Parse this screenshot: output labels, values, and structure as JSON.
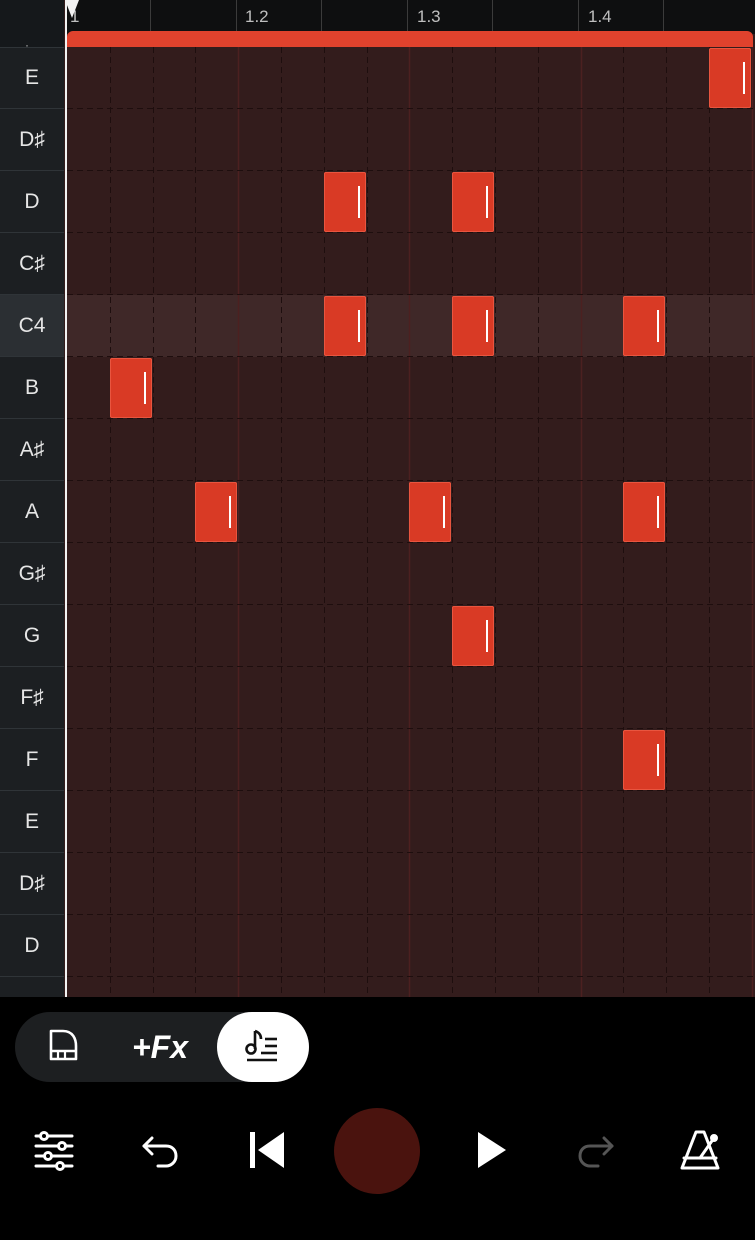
{
  "ruler": {
    "labels": [
      "1",
      "1.2",
      "1.3",
      "1.4"
    ]
  },
  "keys": [
    "E",
    "D♯",
    "D",
    "C♯",
    "C4",
    "B",
    "A♯",
    "A",
    "G♯",
    "G",
    "F♯",
    "F",
    "E",
    "D♯",
    "D"
  ],
  "highlight_key": "C4",
  "notes": [
    {
      "pitch": "D",
      "step": 6
    },
    {
      "pitch": "D",
      "step": 9
    },
    {
      "pitch": "C4",
      "step": 6
    },
    {
      "pitch": "C4",
      "step": 9
    },
    {
      "pitch": "C4",
      "step": 13
    },
    {
      "pitch": "B",
      "step": 1
    },
    {
      "pitch": "A",
      "step": 3
    },
    {
      "pitch": "A",
      "step": 8
    },
    {
      "pitch": "A",
      "step": 13
    },
    {
      "pitch": "G",
      "step": 9
    },
    {
      "pitch": "F",
      "step": 13
    },
    {
      "pitch": "E",
      "step": 15
    }
  ],
  "mode_switcher": {
    "piano_icon": "piano-icon",
    "fx_label": "+Fx",
    "notes_icon": "note-list-icon",
    "active": "notes"
  },
  "transport": {
    "icons": [
      "mixer-sliders-icon",
      "undo-icon",
      "skip-to-start-icon",
      "record-button",
      "play-icon",
      "redo-icon",
      "metronome-icon"
    ]
  },
  "colors": {
    "note": "#d93a25",
    "loop_bar": "#e0422d",
    "grid_bg": "#331c1c",
    "record": "#4a130e"
  }
}
